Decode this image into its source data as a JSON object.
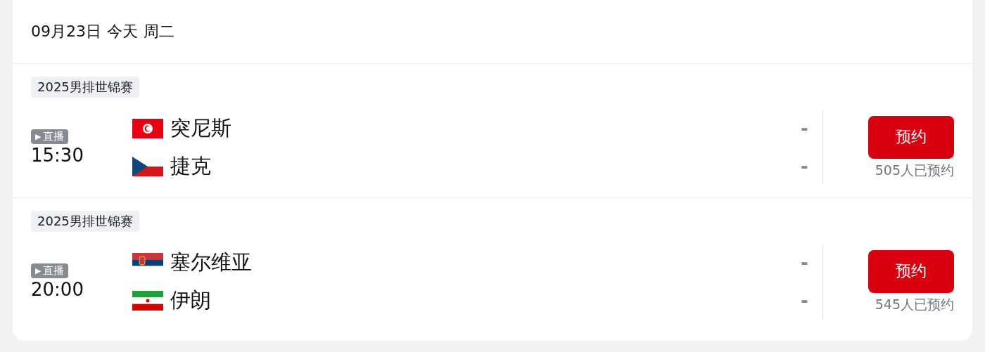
{
  "date_header": {
    "date": "09月23日",
    "day_label": "今天",
    "weekday": "周二"
  },
  "matches": [
    {
      "competition": "2025男排世锦赛",
      "live_badge": {
        "icon": "▶",
        "label": "直播"
      },
      "time": "15:30",
      "teams": [
        {
          "name": "突尼斯",
          "kind": "tunisia",
          "score": "-"
        },
        {
          "name": "捷克",
          "kind": "czechia",
          "score": "-"
        }
      ],
      "button": "预约",
      "reservations": "505人已预约"
    },
    {
      "competition": "2025男排世锦赛",
      "live_badge": {
        "icon": "▶",
        "label": "直播"
      },
      "time": "20:00",
      "teams": [
        {
          "name": "塞尔维亚",
          "kind": "serbia",
          "score": "-"
        },
        {
          "name": "伊朗",
          "kind": "iran",
          "score": "-"
        }
      ],
      "button": "预约",
      "reservations": "545人已预约"
    }
  ]
}
